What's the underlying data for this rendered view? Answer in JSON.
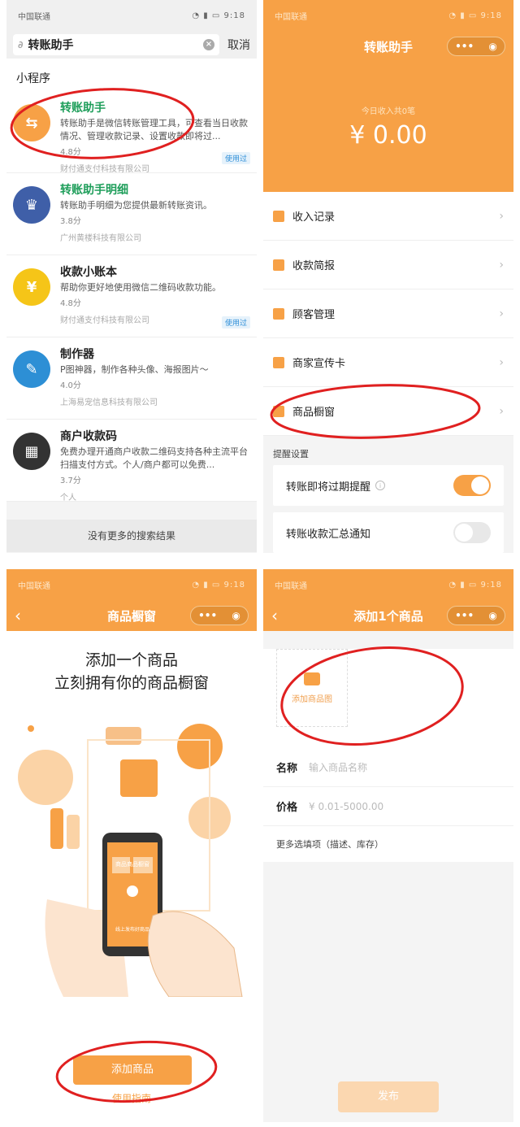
{
  "panel1": {
    "status": {
      "carrier": "中国联通",
      "time": "9:18"
    },
    "search": {
      "query": "转账助手",
      "cancel": "取消"
    },
    "section_title": "小程序",
    "results": [
      {
        "name": "转账助手",
        "desc": "转账助手是微信转账管理工具，可查看当日收款情况、管理收款记录、设置收款即将过...",
        "score": "4.8分",
        "company": "财付通支付科技有限公司",
        "badge": "使用过",
        "color": "#f7a146",
        "glyph": "⇆"
      },
      {
        "name": "转账助手明细",
        "desc": "转账助手明细为您提供最新转账资讯。",
        "score": "3.8分",
        "company": "广州黄楼科技有限公司",
        "badge": "",
        "color": "#3f5fa8",
        "glyph": "♛"
      },
      {
        "name": "收款小账本",
        "desc": "帮助你更好地使用微信二维码收款功能。",
        "score": "4.8分",
        "company": "财付通支付科技有限公司",
        "badge": "使用过",
        "color": "#f5c518",
        "glyph": "¥"
      },
      {
        "name": "制作器",
        "desc": "P图神器，制作各种头像、海报图片～",
        "score": "4.0分",
        "company": "上海易宠信息科技有限公司",
        "badge": "",
        "color": "#2d8fd5",
        "glyph": "✎"
      },
      {
        "name": "商户收款码",
        "desc": "免费办理开通商户收款二维码支持各种主流平台扫描支付方式。个人/商户都可以免费...",
        "score": "3.7分",
        "company": "个人",
        "badge": "",
        "color": "#333333",
        "glyph": "▦"
      }
    ],
    "no_more": "没有更多的搜索结果"
  },
  "panel2": {
    "status": {
      "carrier": "中国联通",
      "time": "9:18"
    },
    "title": "转账助手",
    "income_label": "今日收入共0笔",
    "income_amount": "¥ 0.00",
    "menu": [
      {
        "label": "收入记录"
      },
      {
        "label": "收款简报"
      },
      {
        "label": "顾客管理"
      },
      {
        "label": "商家宣传卡"
      },
      {
        "label": "商品橱窗"
      }
    ],
    "reminder_title": "提醒设置",
    "reminders": [
      {
        "label": "转账即将过期提醒",
        "on": true
      },
      {
        "label": "转账收款汇总通知",
        "on": false
      }
    ]
  },
  "panel3": {
    "status": {
      "carrier": "中国联通",
      "time": "9:18"
    },
    "title": "商品橱窗",
    "headline1": "添加一个商品",
    "headline2": "立刻拥有你的商品橱窗",
    "phone_caption": "商品商品橱窗",
    "phone_footer": "线上发布好商品",
    "add_button": "添加商品",
    "guide": "使用指南"
  },
  "panel4": {
    "status": {
      "carrier": "中国联通",
      "time": "9:18"
    },
    "title": "添加1个商品",
    "add_image": "添加商品图",
    "name_label": "名称",
    "name_placeholder": "输入商品名称",
    "price_label": "价格",
    "price_placeholder": "¥ 0.01-5000.00",
    "more_options": "更多选填项（描述、库存）",
    "publish": "发布"
  },
  "colors": {
    "accent": "#f7a146",
    "highlight": "#1e9e5a",
    "annotation": "#e02020"
  }
}
